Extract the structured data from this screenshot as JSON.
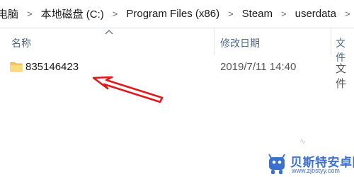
{
  "breadcrumb": {
    "items": [
      "电脑",
      "本地磁盘 (C:)",
      "Program Files (x86)",
      "Steam",
      "userdata"
    ],
    "separator": ">"
  },
  "columns": {
    "name": "名称",
    "date_modified": "修改日期",
    "type": "文件"
  },
  "files": [
    {
      "name": "835146423",
      "date": "2019/7/11 14:40",
      "type": "文件"
    }
  ],
  "annotation": {
    "arrow_color": "#e0191b"
  },
  "faint_mark": "∿",
  "watermark": {
    "title": "贝斯特安卓网",
    "url": "www.zjbstyy.com",
    "color": "#3b6fd0"
  }
}
